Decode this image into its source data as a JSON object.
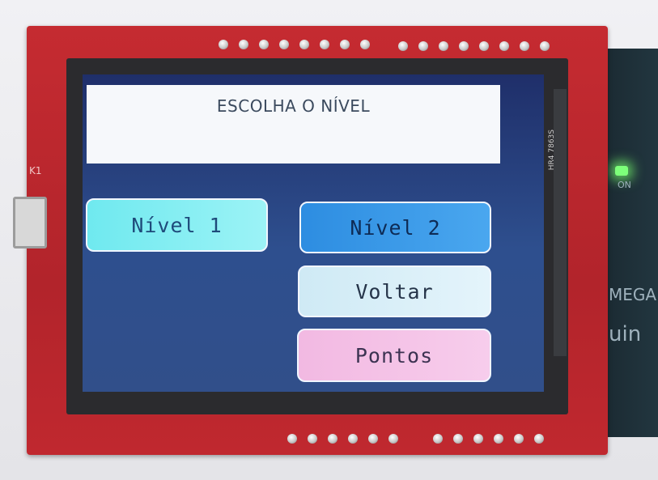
{
  "screen": {
    "title": "ESCOLHA O NÍVEL",
    "buttons": {
      "nivel1": "Nível 1",
      "nivel2": "Nível 2",
      "voltar": "Voltar",
      "pontos": "Pontos"
    }
  },
  "board": {
    "k1_label": "K1",
    "flex_label": "HR4 7863S",
    "arduino_led_label": "ON",
    "arduino_text_1": "MEGA",
    "arduino_text_2": "uin"
  },
  "colors": {
    "pcb": "#c52b31",
    "screen_bg": "#2e4f8e",
    "nivel1": "#8ff0f4",
    "nivel2": "#3a9ae8",
    "voltar": "#dbeff8",
    "pontos": "#f4c3e7"
  }
}
